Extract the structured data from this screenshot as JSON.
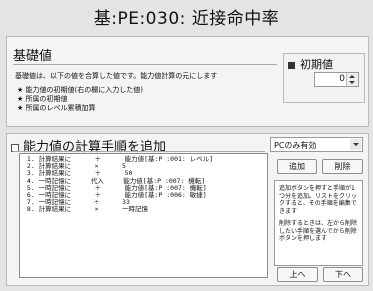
{
  "window": {
    "title": "基:PE:030: 近接命中率"
  },
  "base_section": {
    "heading": "基礎値",
    "description": "基礎値は、以下の値を合算した値です。能力値計算の元にします",
    "bullets": [
      "★ 能力値の初期値(右の欄に入力した値)",
      "★ 所属の初期値",
      "★ 所属のレベル累積加算"
    ],
    "initial_value": {
      "label": "初期値",
      "value": "0"
    }
  },
  "calc_section": {
    "heading": "能力値の計算手順を追加",
    "target_select": "PCのみ有効",
    "steps": [
      " 1. 計算結果に      ＋      能力値[基:P :001: レベル]",
      " 2. 計算結果に      ×      5",
      " 3. 計算結果に      ＋      50",
      " 4. 一時記憶に     代入     能力値[基:P :007: 機転]",
      " 5. 一時記憶に      ＋      能力値[基:P :007: 機転]",
      " 6. 一時記憶に      ＋      能力値[基:P :006: 敏捷]",
      " 7. 一時記憶に      ÷      33",
      " 8. 計算結果に      ×      一時記憶"
    ],
    "buttons": {
      "add": "追加",
      "delete": "削除",
      "up": "上へ",
      "down": "下へ"
    },
    "help": [
      "追加ボタンを押すと手順が1つ分を追加。リストをクリックすると、その手順を編集できます",
      "削除するときは、左から削除したい手順を選んでから削除ボタンを押します"
    ]
  }
}
